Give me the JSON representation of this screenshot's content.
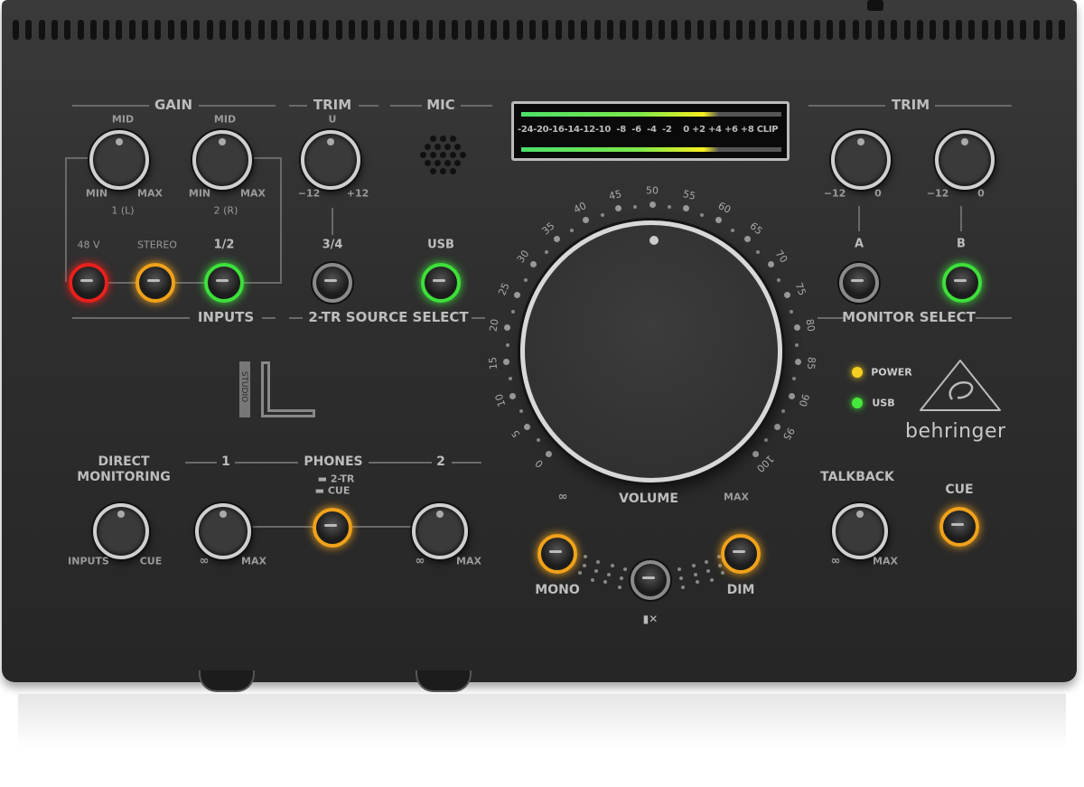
{
  "brand": "behringer",
  "model_logo": "STUDIO L",
  "top_left": {
    "gain_header": "GAIN",
    "trim_header": "TRIM",
    "mic_header": "MIC",
    "knobs": [
      {
        "top": "MID",
        "min": "MIN",
        "max": "MAX",
        "channel": "1 (L)"
      },
      {
        "top": "MID",
        "min": "MIN",
        "max": "MAX",
        "channel": "2 (R)"
      },
      {
        "top": "U",
        "min": "−12",
        "max": "+12"
      }
    ],
    "buttons": [
      {
        "label": "48 V",
        "color": "#e8201c"
      },
      {
        "label": "STEREO",
        "color": "#f0a21a"
      },
      {
        "label": "1/2",
        "color": "#3ee03a"
      },
      {
        "label": "3/4",
        "color": "#8a8a8a"
      },
      {
        "label": "USB",
        "color": "#3ee03a"
      }
    ],
    "inputs_label": "INPUTS",
    "source_select_label": "2-TR SOURCE SELECT"
  },
  "meter": {
    "scale": "-24-20-16-14-12-10  -8  -6  -4  -2    0 +2 +4 +6 +8 CLIP",
    "level_db": 0
  },
  "volume": {
    "label": "VOLUME",
    "min_label": "∞",
    "max_label": "MAX",
    "scale": [
      "0",
      "5",
      "10",
      "15",
      "20",
      "25",
      "30",
      "35",
      "40",
      "45",
      "50",
      "55",
      "60",
      "65",
      "70",
      "75",
      "80",
      "85",
      "90",
      "95",
      "100"
    ],
    "position_percent": 50
  },
  "monitor": {
    "trim_header": "TRIM",
    "knobs": [
      {
        "min": "−12",
        "max": "0",
        "output": "A"
      },
      {
        "min": "−12",
        "max": "0",
        "output": "B"
      }
    ],
    "buttons": [
      {
        "color": "#8a8a8a"
      },
      {
        "color": "#3ee03a"
      }
    ],
    "select_label": "MONITOR SELECT"
  },
  "status": [
    {
      "label": "POWER",
      "color": "#f5d020"
    },
    {
      "label": "USB",
      "color": "#45e83a"
    }
  ],
  "bottom_left": {
    "direct_monitoring": [
      "DIRECT",
      "MONITORING"
    ],
    "dm_min": "INPUTS",
    "dm_max": "CUE",
    "phones_header": "PHONES",
    "phones_1": "1",
    "phones_2": "2",
    "phones_opt1": "2-TR",
    "phones_opt2": "CUE",
    "min": "∞",
    "max": "MAX",
    "button_color": "#f0a21a"
  },
  "center_bottom": {
    "mono": "MONO",
    "dim": "DIM",
    "mute_icon": "speaker-mute-icon",
    "mono_color": "#f0a21a",
    "dim_color": "#f0a21a",
    "mute_color": "#8a8a8a"
  },
  "talkback": {
    "label": "TALKBACK",
    "min": "∞",
    "max": "MAX",
    "cue": "CUE",
    "cue_color": "#f0a21a"
  }
}
